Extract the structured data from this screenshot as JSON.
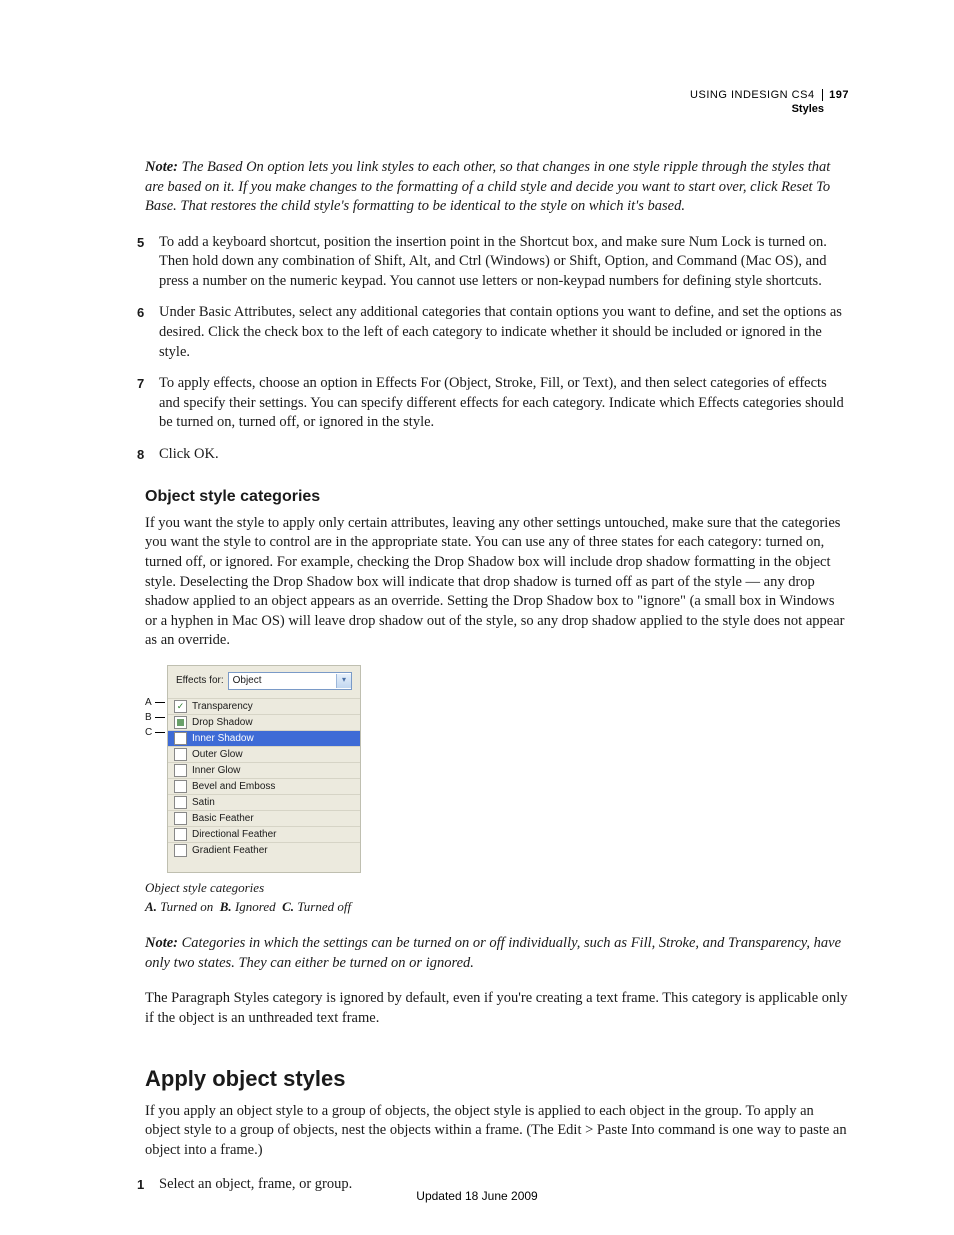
{
  "header": {
    "book": "USING INDESIGN CS4",
    "chapter": "Styles",
    "page": "197"
  },
  "note1": {
    "label": "Note:",
    "text": "The Based On option lets you link styles to each other, so that changes in one style ripple through the styles that are based on it. If you make changes to the formatting of a child style and decide you want to start over, click Reset To Base. That restores the child style's formatting to be identical to the style on which it's based."
  },
  "steps": [
    {
      "n": "5",
      "t": "To add a keyboard shortcut, position the insertion point in the Shortcut box, and make sure Num Lock is turned on. Then hold down any combination of Shift, Alt, and Ctrl (Windows) or Shift, Option, and Command (Mac OS), and press a number on the numeric keypad. You cannot use letters or non-keypad numbers for defining style shortcuts."
    },
    {
      "n": "6",
      "t": "Under Basic Attributes, select any additional categories that contain options you want to define, and set the options as desired. Click the check box to the left of each category to indicate whether it should be included or ignored in the style."
    },
    {
      "n": "7",
      "t": "To apply effects, choose an option in Effects For (Object, Stroke, Fill, or Text), and then select categories of effects and specify their settings. You can specify different effects for each category. Indicate which Effects categories should be turned on, turned off, or ignored in the style."
    },
    {
      "n": "8",
      "t": "Click OK."
    }
  ],
  "subhead1": "Object style categories",
  "para1": "If you want the style to apply only certain attributes, leaving any other settings untouched, make sure that the categories you want the style to control are in the appropriate state. You can use any of three states for each category: turned on, turned off, or ignored. For example, checking the Drop Shadow box will include drop shadow formatting in the object style. Deselecting the Drop Shadow box will indicate that drop shadow is turned off as part of the style — any drop shadow applied to an object appears as an override. Setting the Drop Shadow box to \"ignore\" (a small box in Windows or a hyphen in Mac OS) will leave drop shadow out of the style, so any drop shadow applied to the style does not appear as an override.",
  "figure": {
    "effectsForLabel": "Effects for:",
    "effectsForValue": "Object",
    "rows": [
      {
        "label": "Transparency",
        "state": "checked",
        "selected": false
      },
      {
        "label": "Drop Shadow",
        "state": "mixed",
        "selected": false
      },
      {
        "label": "Inner Shadow",
        "state": "off",
        "selected": true
      },
      {
        "label": "Outer Glow",
        "state": "off",
        "selected": false
      },
      {
        "label": "Inner Glow",
        "state": "off",
        "selected": false
      },
      {
        "label": "Bevel and Emboss",
        "state": "off",
        "selected": false
      },
      {
        "label": "Satin",
        "state": "off",
        "selected": false
      },
      {
        "label": "Basic Feather",
        "state": "off",
        "selected": false
      },
      {
        "label": "Directional Feather",
        "state": "off",
        "selected": false
      },
      {
        "label": "Gradient Feather",
        "state": "off",
        "selected": false
      }
    ],
    "callouts": {
      "A": "A",
      "B": "B",
      "C": "C"
    },
    "caption": "Object style categories",
    "legend": {
      "A": {
        "k": "A.",
        "v": "Turned on"
      },
      "B": {
        "k": "B.",
        "v": "Ignored"
      },
      "C": {
        "k": "C.",
        "v": "Turned off"
      }
    }
  },
  "note2": {
    "label": "Note:",
    "text": "Categories in which the settings can be turned on or off individually, such as Fill, Stroke, and Transparency, have only two states. They can either be turned on or ignored."
  },
  "para2": "The Paragraph Styles category is ignored by default, even if you're creating a text frame. This category is applicable only if the object is an unthreaded text frame.",
  "section2": "Apply object styles",
  "para3": "If you apply an object style to a group of objects, the object style is applied to each object in the group. To apply an object style to a group of objects, nest the objects within a frame. (The Edit > Paste Into command is one way to paste an object into a frame.)",
  "steps2": [
    {
      "n": "1",
      "t": "Select an object, frame, or group."
    }
  ],
  "footer": "Updated 18 June 2009"
}
